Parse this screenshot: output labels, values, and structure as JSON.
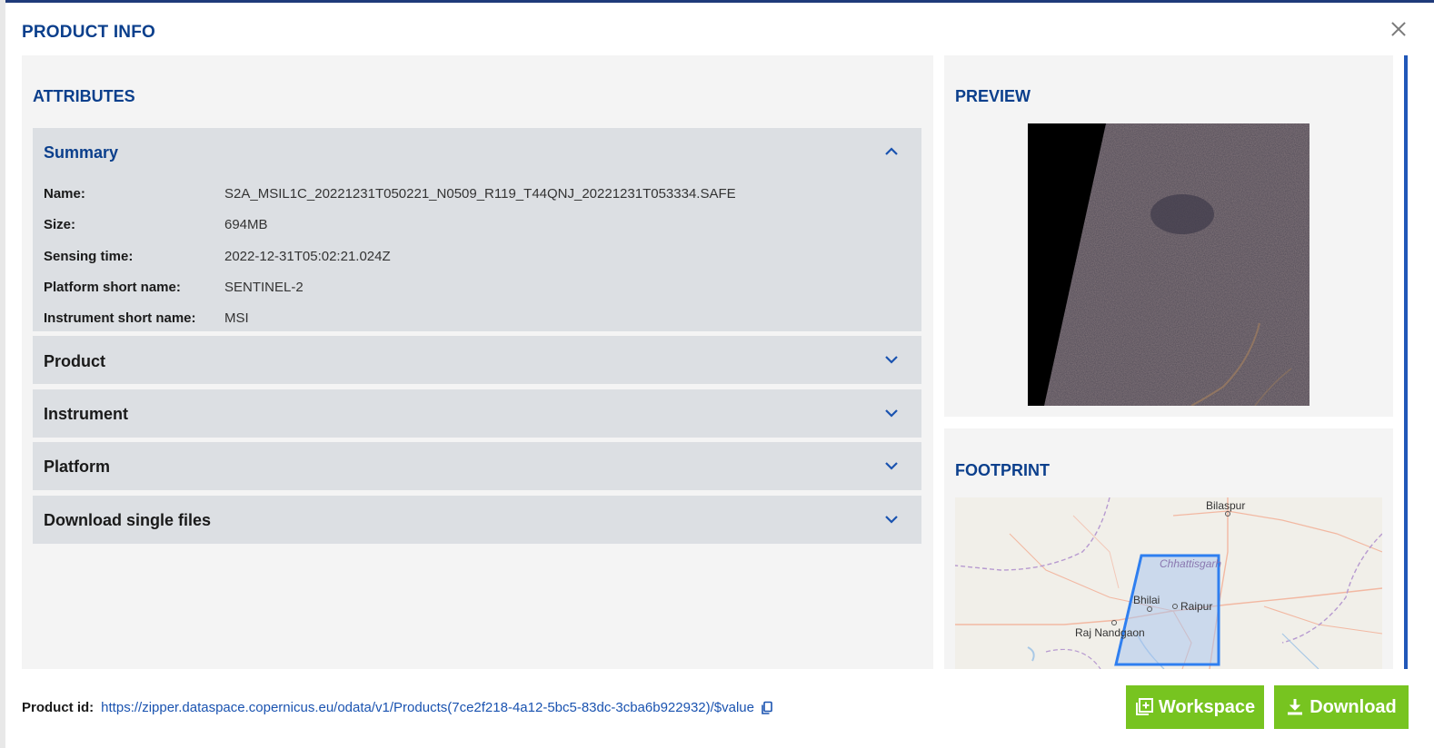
{
  "modal": {
    "title": "PRODUCT INFO",
    "close_icon": "close-icon"
  },
  "attributes": {
    "heading": "ATTRIBUTES",
    "sections": [
      {
        "label": "Summary",
        "expanded": true,
        "rows": [
          {
            "key": "Name:",
            "value": "S2A_MSIL1C_20221231T050221_N0509_R119_T44QNJ_20221231T053334.SAFE"
          },
          {
            "key": "Size:",
            "value": "694MB"
          },
          {
            "key": "Sensing time:",
            "value": "2022-12-31T05:02:21.024Z"
          },
          {
            "key": "Platform short name:",
            "value": "SENTINEL-2"
          },
          {
            "key": "Instrument short name:",
            "value": "MSI"
          }
        ]
      },
      {
        "label": "Product",
        "expanded": false
      },
      {
        "label": "Instrument",
        "expanded": false
      },
      {
        "label": "Platform",
        "expanded": false
      },
      {
        "label": "Download single files",
        "expanded": false
      }
    ]
  },
  "preview": {
    "heading": "PREVIEW"
  },
  "footprint": {
    "heading": "FOOTPRINT",
    "map_labels": {
      "bilaspur": "Bilaspur",
      "chhattisgarh": "Chhattisgarh",
      "bhilai": "Bhilai",
      "raipur": "Raipur",
      "raj_nandgaon": "Raj Nandgaon"
    }
  },
  "footer": {
    "product_id_label": "Product id:",
    "product_id_url": "https://zipper.dataspace.copernicus.eu/odata/v1/Products(7ce2f218-4a12-5bc5-83dc-3cba6b922932)/$value"
  },
  "buttons": {
    "workspace": "Workspace",
    "download": "Download"
  },
  "colors": {
    "accent_blue": "#0b3f8c",
    "button_green": "#77c420",
    "footprint_outline": "#2f7ff0"
  }
}
